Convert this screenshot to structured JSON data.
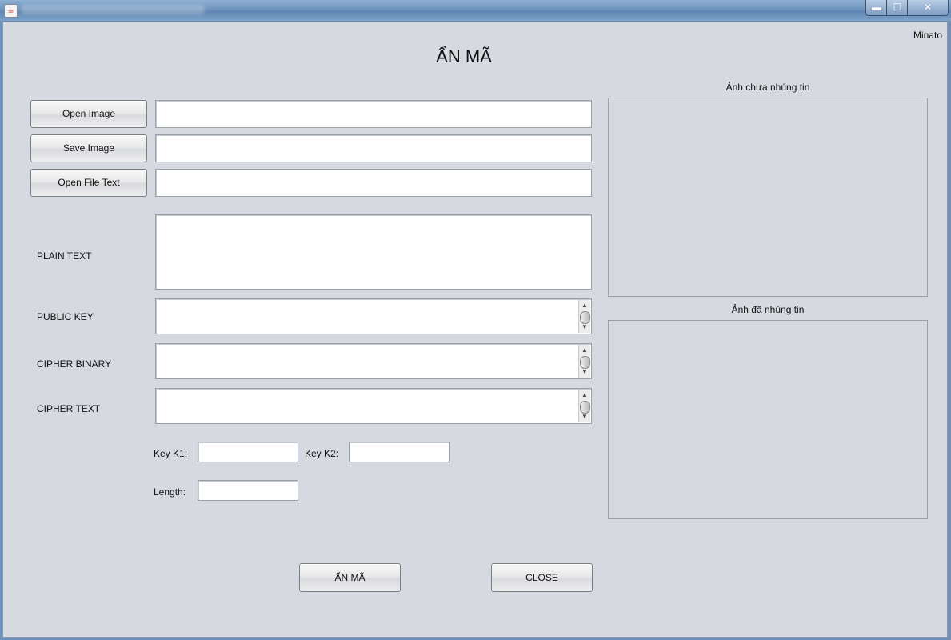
{
  "window": {
    "min_glyph": "▬",
    "max_glyph": "☐",
    "close_glyph": "✕"
  },
  "header": {
    "author": "Minato",
    "title": "ẨN MÃ"
  },
  "files": {
    "open_image_label": "Open Image",
    "open_image_path": "",
    "save_image_label": "Save Image",
    "save_image_path": "",
    "open_text_label": "Open File Text",
    "open_text_path": ""
  },
  "fields": {
    "plain_text_label": "PLAIN TEXT",
    "plain_text_value": "",
    "public_key_label": "PUBLIC KEY",
    "public_key_value": "",
    "cipher_binary_label": "CIPHER BINARY",
    "cipher_binary_value": "",
    "cipher_text_label": "CIPHER TEXT",
    "cipher_text_value": ""
  },
  "keys": {
    "k1_label": "Key K1:",
    "k1_value": "",
    "k2_label": "Key K2:",
    "k2_value": "",
    "length_label": "Length:",
    "length_value": ""
  },
  "images": {
    "original_caption": "Ảnh chưa nhúng tin",
    "embedded_caption": "Ảnh đã nhúng tin"
  },
  "actions": {
    "hide_label": "ẨN MÃ",
    "close_label": "CLOSE"
  },
  "icons": {
    "app": "java-cup-icon",
    "scroll_up": "▲",
    "scroll_down": "▼"
  }
}
